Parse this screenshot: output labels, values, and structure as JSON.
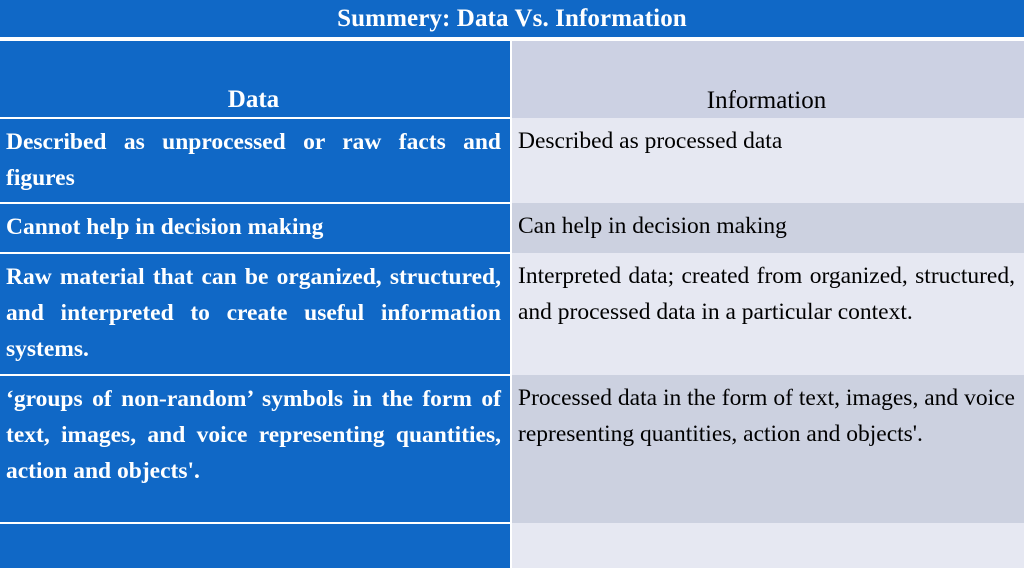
{
  "slide": {
    "title": "Summery: Data Vs. Information",
    "accent_color": "#1068C6",
    "title_text_color": "#FFFFFF",
    "right_header_bg": "#CCD1E3",
    "right_light_bg": "#E6E8F2",
    "right_shade_bg": "#CCD1E0"
  },
  "table": {
    "headers": {
      "left": "Data",
      "right": "Information"
    },
    "rows": [
      {
        "left": "Described as unprocessed or raw facts and figures",
        "right": "Described as processed data"
      },
      {
        "left": "Cannot help in decision making",
        "right": "Can help in decision making"
      },
      {
        "left": "Raw material that can be organized, structured, and interpreted to create useful information systems.",
        "right": "Interpreted data; created from organized, structured, and processed data in a particular context."
      },
      {
        "left": "‘groups of non-random’ symbols in the form of text, images, and voice representing quantities, action and objects'.",
        "right": "Processed data in the form of text, images, and voice representing quantities, action and objects'."
      },
      {
        "left": "",
        "right": ""
      }
    ]
  }
}
